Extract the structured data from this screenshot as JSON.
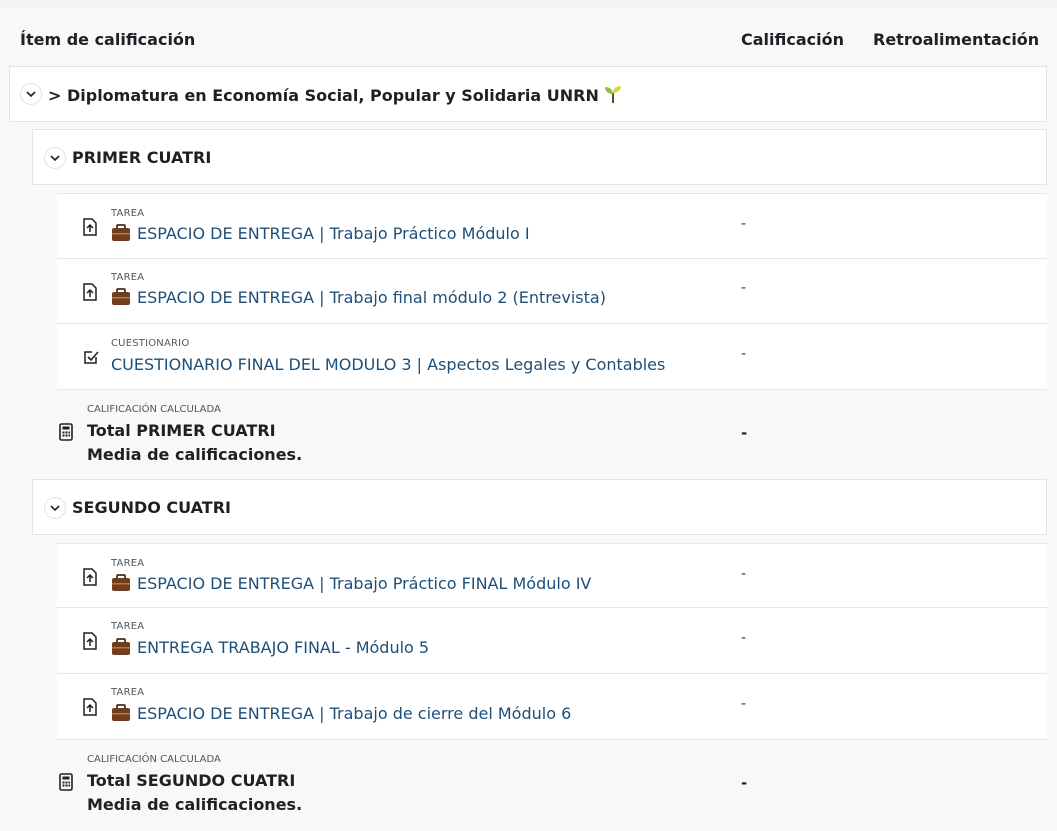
{
  "header": {
    "item_label": "Ítem de calificación",
    "grade_label": "Calificación",
    "feedback_label": "Retroalimentación"
  },
  "course": {
    "title": "> Diplomatura en Economía Social, Popular y Solidaria UNRN"
  },
  "categories": [
    {
      "title": "PRIMER CUATRI",
      "items": [
        {
          "type": "TAREA",
          "name": "ESPACIO DE ENTREGA | Trabajo Práctico Módulo I",
          "grade": "-",
          "icon": "assignment-icon",
          "briefcase": true
        },
        {
          "type": "TAREA",
          "name": "ESPACIO DE ENTREGA | Trabajo final módulo 2 (Entrevista)",
          "grade": "-",
          "icon": "assignment-icon",
          "briefcase": true
        },
        {
          "type": "CUESTIONARIO",
          "name": "CUESTIONARIO FINAL DEL MODULO 3 | Aspectos Legales y Contables",
          "grade": "-",
          "icon": "quiz-icon",
          "briefcase": false
        }
      ],
      "calc": {
        "type": "CALIFICACIÓN CALCULADA",
        "total": "Total PRIMER CUATRI",
        "avg": "Media de calificaciones.",
        "grade": "-"
      }
    },
    {
      "title": "SEGUNDO CUATRI",
      "items": [
        {
          "type": "TAREA",
          "name": "ESPACIO DE ENTREGA | Trabajo Práctico FINAL Módulo IV",
          "grade": "-",
          "icon": "assignment-icon",
          "briefcase": true
        },
        {
          "type": "TAREA",
          "name": "ENTREGA TRABAJO FINAL - Módulo 5",
          "grade": "-",
          "icon": "assignment-icon",
          "briefcase": true
        },
        {
          "type": "TAREA",
          "name": "ESPACIO DE ENTREGA | Trabajo de cierre del Módulo 6",
          "grade": "-",
          "icon": "assignment-icon",
          "briefcase": true
        }
      ],
      "calc": {
        "type": "CALIFICACIÓN CALCULADA",
        "total": "Total SEGUNDO CUATRI",
        "avg": "Media de calificaciones.",
        "grade": "-"
      }
    }
  ],
  "colors": {
    "link": "#1f4f78",
    "text": "#1d2125",
    "border": "#e2e4e6"
  }
}
